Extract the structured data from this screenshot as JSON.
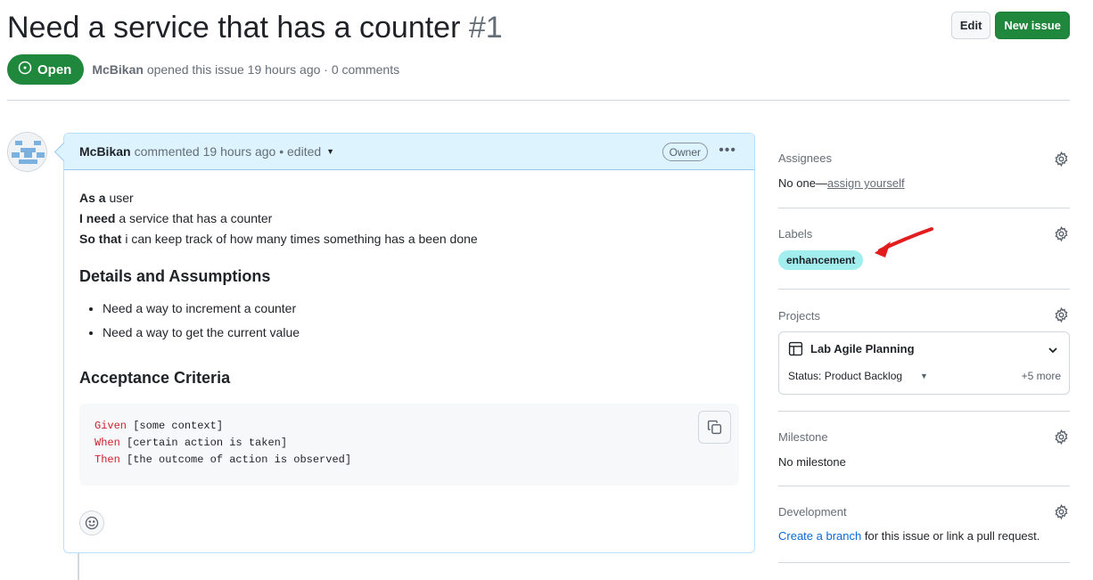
{
  "issue": {
    "title": "Need a service that has a counter",
    "number": "#1",
    "state": "Open",
    "author": "McBikan",
    "meta": "opened this issue 19 hours ago · 0 comments"
  },
  "header_buttons": {
    "edit": "Edit",
    "new_issue": "New issue"
  },
  "comment": {
    "author": "McBikan",
    "meta": "commented 19 hours ago • edited",
    "badge": "Owner",
    "story": [
      {
        "bold": "As a",
        "text": " user"
      },
      {
        "bold": "I need",
        "text": " a service that has a counter"
      },
      {
        "bold": "So that",
        "text": " i can keep track of how many times something has a been done"
      }
    ],
    "details_heading": "Details and Assumptions",
    "details_items": [
      "Need a way to increment a counter",
      "Need a way to get the current value"
    ],
    "acceptance_heading": "Acceptance Criteria",
    "code_lines": [
      {
        "kw": "Given",
        "text": " [some context]"
      },
      {
        "kw": "When",
        "text": " [certain action is taken]"
      },
      {
        "kw": "Then",
        "text": " [the outcome of action is observed]"
      }
    ]
  },
  "sidebar": {
    "assignees": {
      "title": "Assignees",
      "prefix": "No one—",
      "link": "assign yourself"
    },
    "labels": {
      "title": "Labels",
      "items": [
        "enhancement"
      ],
      "color": "#a2eeef"
    },
    "projects": {
      "title": "Projects",
      "name": "Lab Agile Planning",
      "status": "Status: Product Backlog",
      "more": "+5 more"
    },
    "milestone": {
      "title": "Milestone",
      "value": "No milestone"
    },
    "development": {
      "title": "Development",
      "link": "Create a branch",
      "text": " for this issue or link a pull request."
    }
  },
  "colors": {
    "accent_green": "#1f883d",
    "comment_header": "#ddf4ff",
    "annotation_arrow": "#e11d1d"
  },
  "icons": [
    "issue-open-icon",
    "caret-down-icon",
    "kebab-icon",
    "copy-icon",
    "smiley-icon",
    "gear-icon",
    "table-icon",
    "chevron-down-icon",
    "red-arrow-annotation"
  ]
}
